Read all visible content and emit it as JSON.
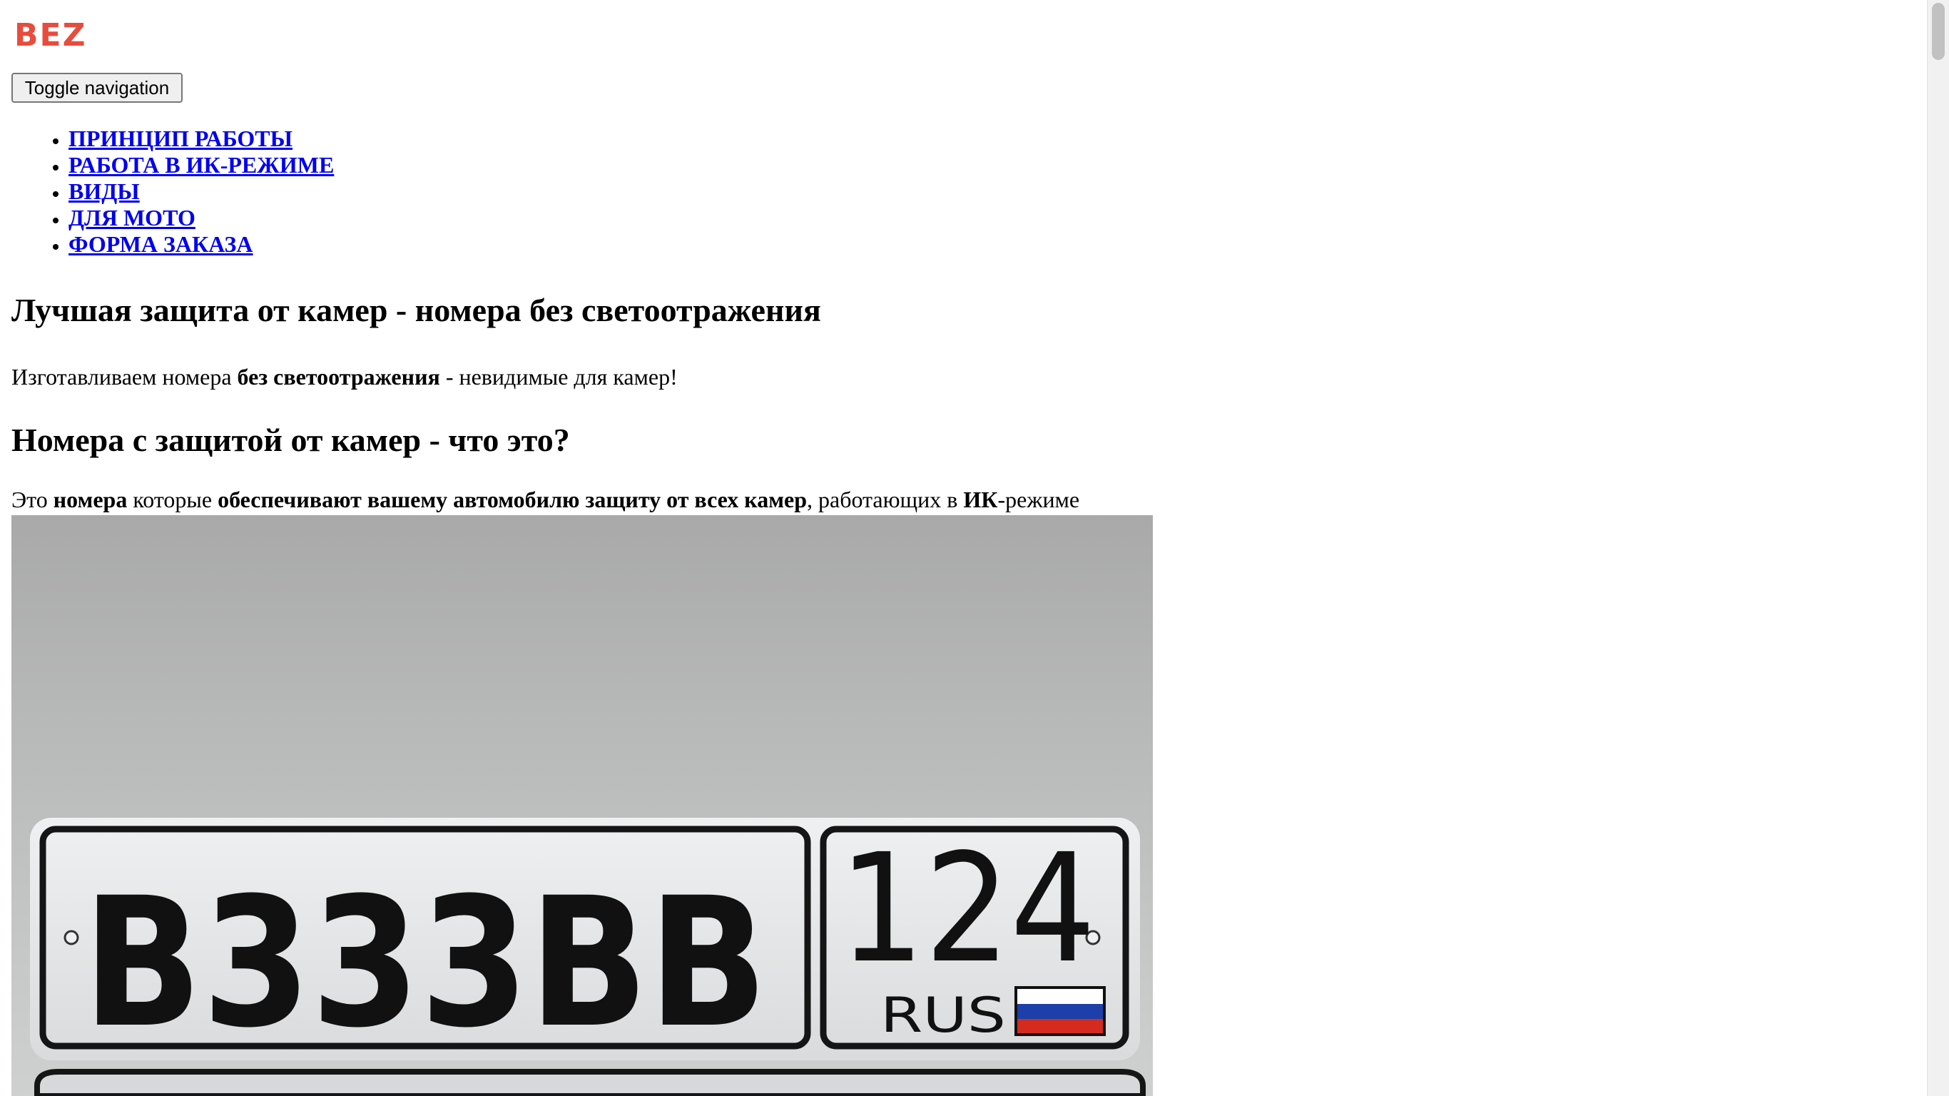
{
  "logo": {
    "text": "BEZ"
  },
  "navbar": {
    "toggle_label": "Toggle navigation"
  },
  "nav": {
    "items": [
      {
        "label": "ПРИНЦИП РАБОТЫ"
      },
      {
        "label": "РАБОТА В ИК-РЕЖИМЕ"
      },
      {
        "label": "ВИДЫ"
      },
      {
        "label": "ДЛЯ МОТО"
      },
      {
        "label": "ФОРМА ЗАКАЗА"
      }
    ]
  },
  "hero": {
    "title": "Лучшая защита от камер - номера без светоотражения",
    "intro": {
      "part1": "Изготавливаем номера ",
      "bold1": "без светоотражения",
      "part2": " - невидимые для камер!"
    }
  },
  "section": {
    "title": "Номера с защитой от камер - что это?",
    "text": {
      "t1": "Это ",
      "b1": "номера",
      "t2": " которые ",
      "b2": "обеспечивают вашему автомобилю защиту от всех камер",
      "t3": ", работающих в ",
      "b3": "ИК",
      "t4": "-режиме"
    }
  },
  "plate": {
    "series": "B333BB",
    "region": "124",
    "country": "RUS",
    "flag_colors": [
      "#ffffff",
      "#1c3faa",
      "#d52b1e"
    ]
  },
  "colors": {
    "logo": "#e84c3d",
    "link": "#0000ee"
  }
}
